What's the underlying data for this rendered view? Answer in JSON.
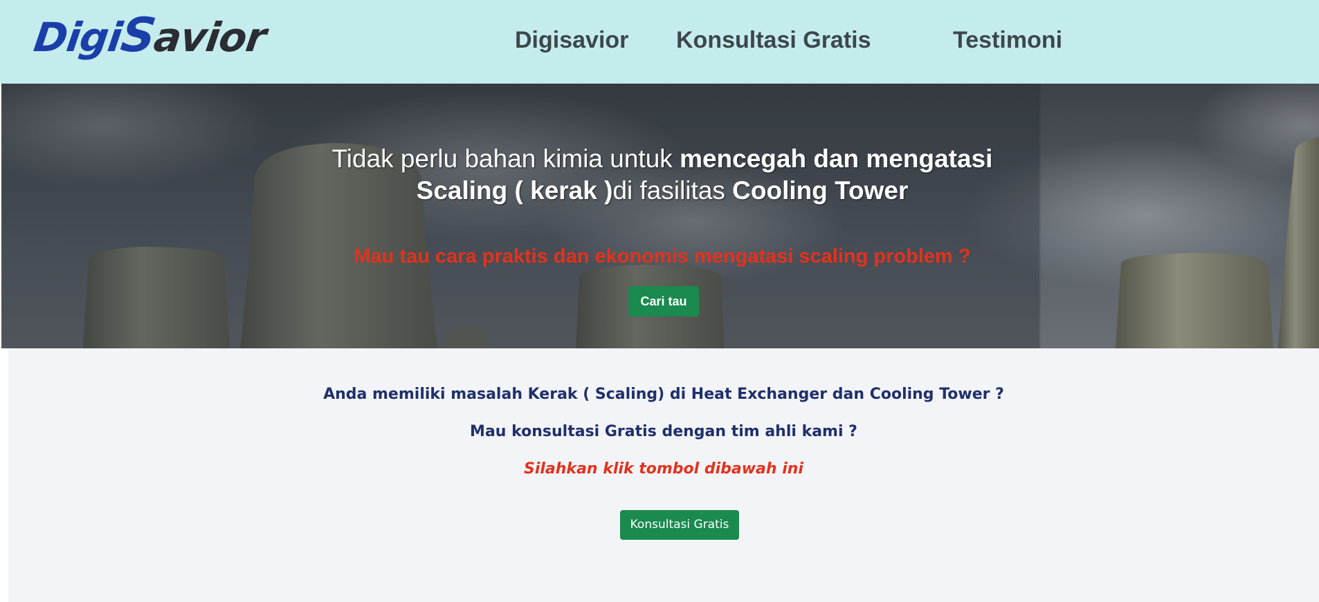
{
  "header": {
    "logo": {
      "part1": "Digi",
      "part2": "S",
      "part3": "avior"
    },
    "nav": [
      {
        "label": "Digisavior"
      },
      {
        "label": "Konsultasi Gratis"
      },
      {
        "label": "Testimoni"
      }
    ]
  },
  "hero": {
    "title_1": "Tidak perlu bahan kimia untuk ",
    "title_2": "mencegah dan mengatasi",
    "title_3": "Scaling ( kerak )",
    "title_4": "di fasilitas ",
    "title_5": "Cooling Tower",
    "subtitle": "Mau tau cara praktis dan ekonomis mengatasi scaling problem ?",
    "button_label": "Cari tau"
  },
  "content": {
    "question_1": "Anda memiliki masalah Kerak ( Scaling) di Heat Exchanger dan Cooling Tower ?",
    "question_2": "Mau konsultasi Gratis dengan tim ahli kami ?",
    "cta_text": "Silahkan klik tombol dibawah ini",
    "button_label": "Konsultasi Gratis"
  },
  "colors": {
    "header_bg": "#c5eced",
    "accent_green": "#1a8a4f",
    "accent_red": "#e3321d",
    "navy_text": "#1e2f6b"
  }
}
